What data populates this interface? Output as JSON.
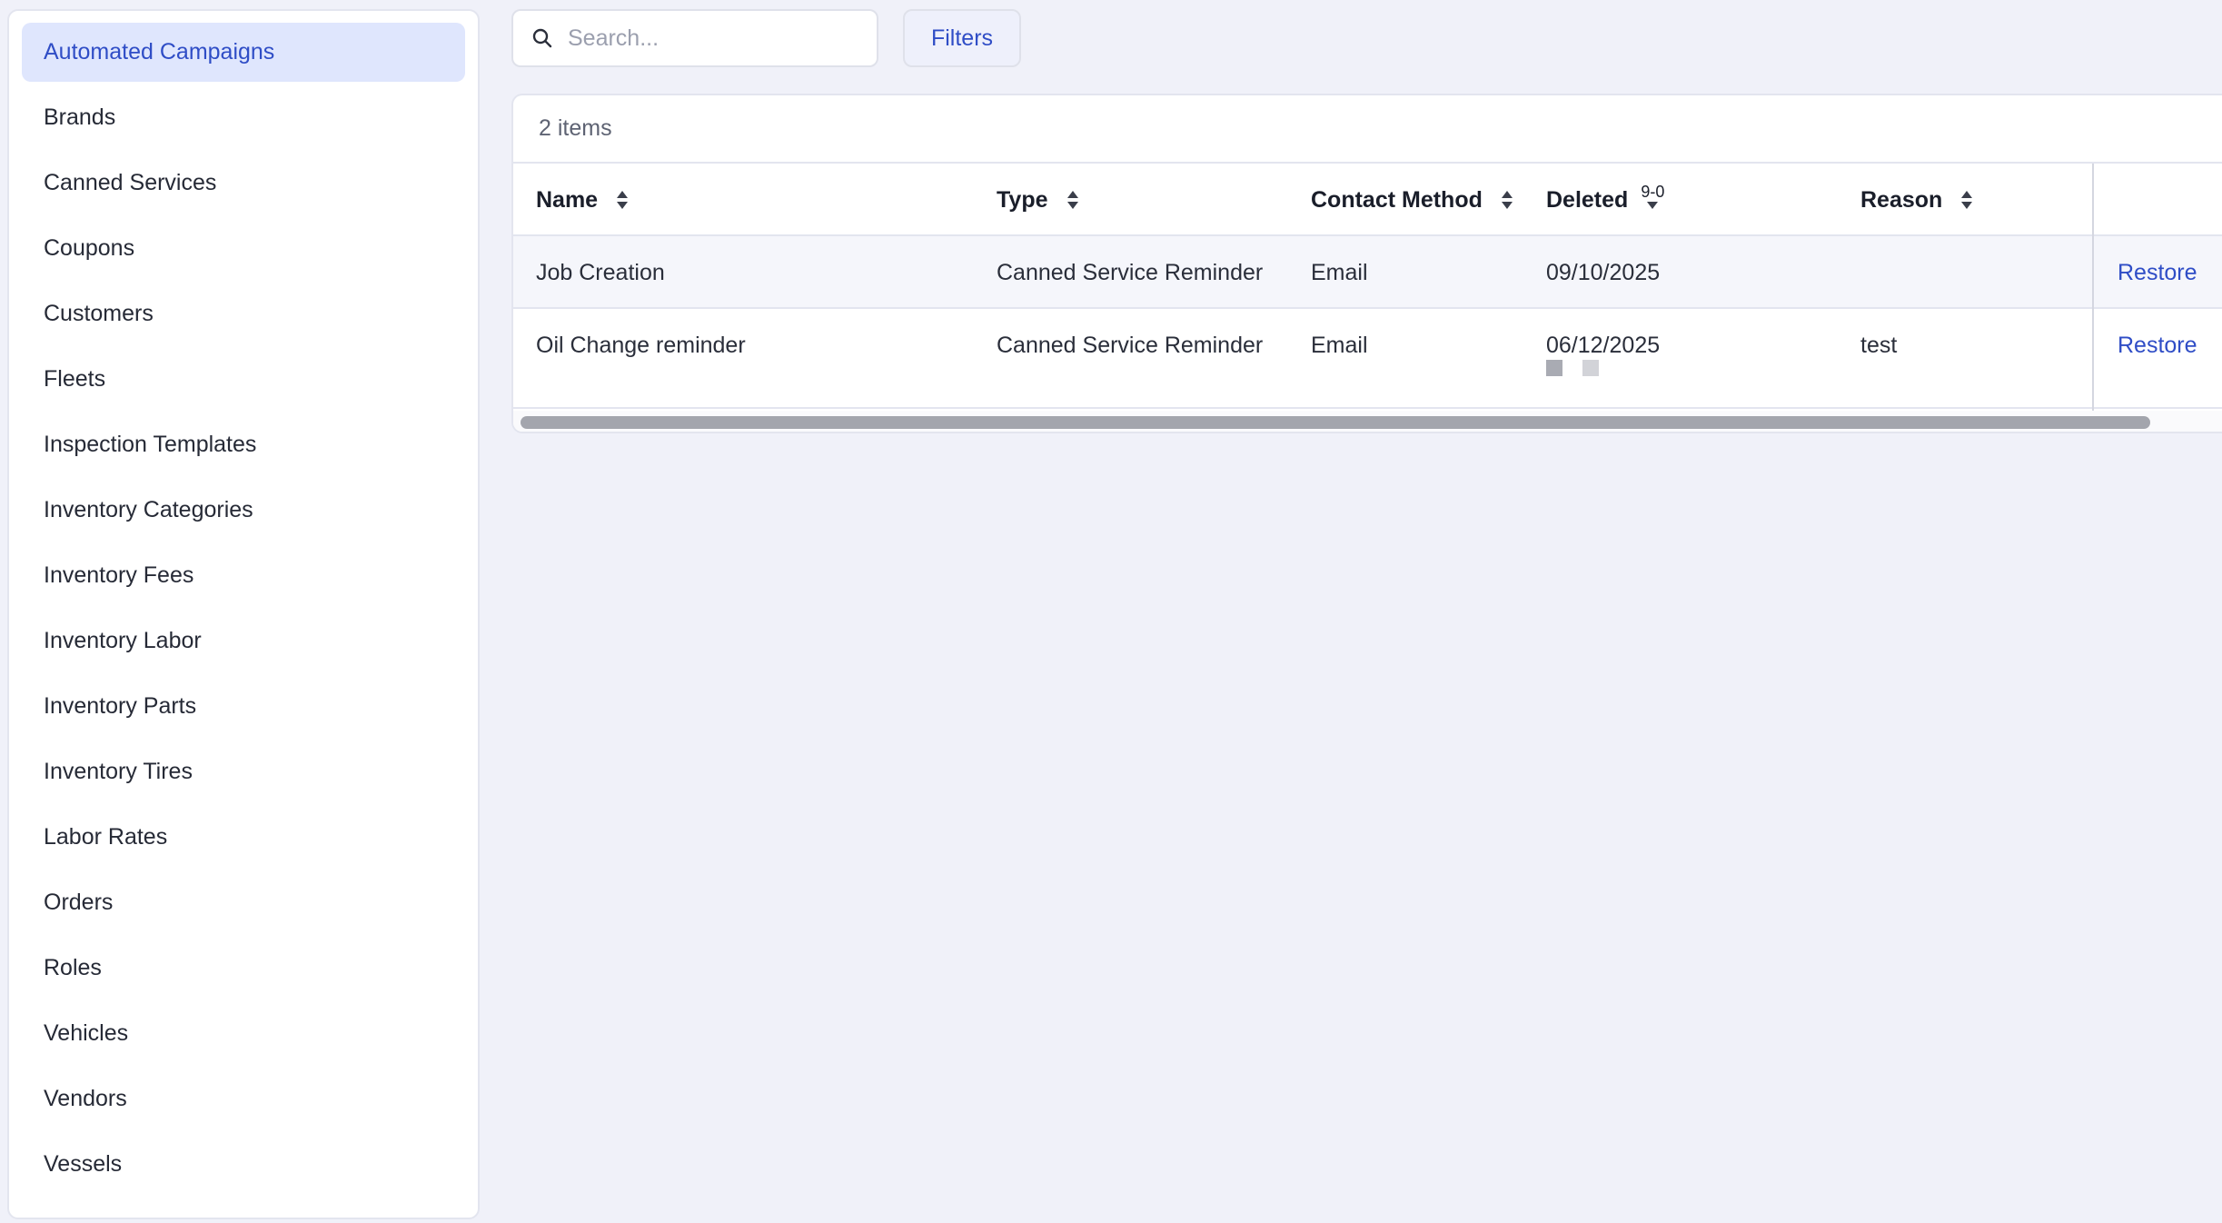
{
  "sidebar": {
    "items": [
      {
        "label": "Automated Campaigns",
        "active": true
      },
      {
        "label": "Brands"
      },
      {
        "label": "Canned Services"
      },
      {
        "label": "Coupons"
      },
      {
        "label": "Customers"
      },
      {
        "label": "Fleets"
      },
      {
        "label": "Inspection Templates"
      },
      {
        "label": "Inventory Categories"
      },
      {
        "label": "Inventory Fees"
      },
      {
        "label": "Inventory Labor"
      },
      {
        "label": "Inventory Parts"
      },
      {
        "label": "Inventory Tires"
      },
      {
        "label": "Labor Rates"
      },
      {
        "label": "Orders"
      },
      {
        "label": "Roles"
      },
      {
        "label": "Vehicles"
      },
      {
        "label": "Vendors"
      },
      {
        "label": "Vessels"
      }
    ]
  },
  "search": {
    "placeholder": "Search...",
    "value": "",
    "icon": "search-icon"
  },
  "filters": {
    "label": "Filters"
  },
  "table": {
    "count_label": "2 items",
    "columns": {
      "name": "Name",
      "type": "Type",
      "contact_method": "Contact Method",
      "deleted": "Deleted",
      "deleted_sort_badge": "9-0",
      "reason": "Reason"
    },
    "rows": [
      {
        "name": "Job Creation",
        "type": "Canned Service Reminder",
        "contact_method": "Email",
        "deleted": "09/10/2025",
        "reason": "",
        "action": "Restore"
      },
      {
        "name": "Oil Change reminder",
        "type": "Canned Service Reminder",
        "contact_method": "Email",
        "deleted": "06/12/2025",
        "reason": "test",
        "action": "Restore"
      }
    ]
  },
  "colors": {
    "accent": "#2f4dc6",
    "active_bg": "#dfe6fd",
    "page_bg": "#f0f1f9"
  }
}
